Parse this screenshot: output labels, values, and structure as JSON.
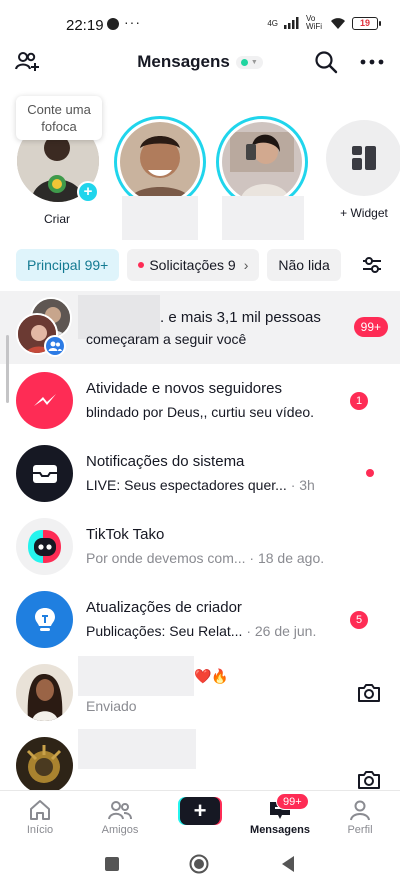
{
  "status": {
    "time": "22:19",
    "more": "···",
    "network": "4G",
    "wifi_label": "Vo WiFi",
    "battery": "19"
  },
  "header": {
    "title": "Mensagens"
  },
  "stories": {
    "create_bubble": "Conte uma fofoca",
    "create_label": "Criar",
    "widget_label": "+ Widget"
  },
  "tabs": [
    {
      "label": "Principal 99+"
    },
    {
      "label": "Solicitações 9"
    },
    {
      "label": "Não lida"
    }
  ],
  "messages": [
    {
      "title": ". e mais 3,1 mil pessoas",
      "subtitle": "começaram a seguir você",
      "badge": "99+"
    },
    {
      "title": "Atividade e novos seguidores",
      "subtitle": "blindado por Deus,, curtiu seu vídeo.",
      "badge": "1"
    },
    {
      "title": "Notificações do sistema",
      "subtitle": "LIVE: Seus espectadores quer...",
      "time": "· 3h"
    },
    {
      "title": "TikTok Tako",
      "subtitle": "Por onde devemos com...",
      "time": "· 18 de ago."
    },
    {
      "title": "Atualizações de criador",
      "subtitle": "Publicações: Seu Relat...",
      "time": "· 26 de jun.",
      "badge": "5"
    },
    {
      "title": "❤️🔥",
      "subtitle": "Enviado"
    },
    {
      "title": "",
      "subtitle": ""
    }
  ],
  "nav": {
    "home": "Início",
    "friends": "Amigos",
    "create": "+",
    "inbox": "Mensagens",
    "inbox_badge": "99+",
    "profile": "Perfil"
  },
  "colors": {
    "accent": "#fe2c55",
    "cyan": "#20d5ec",
    "online": "#20d5a0"
  }
}
